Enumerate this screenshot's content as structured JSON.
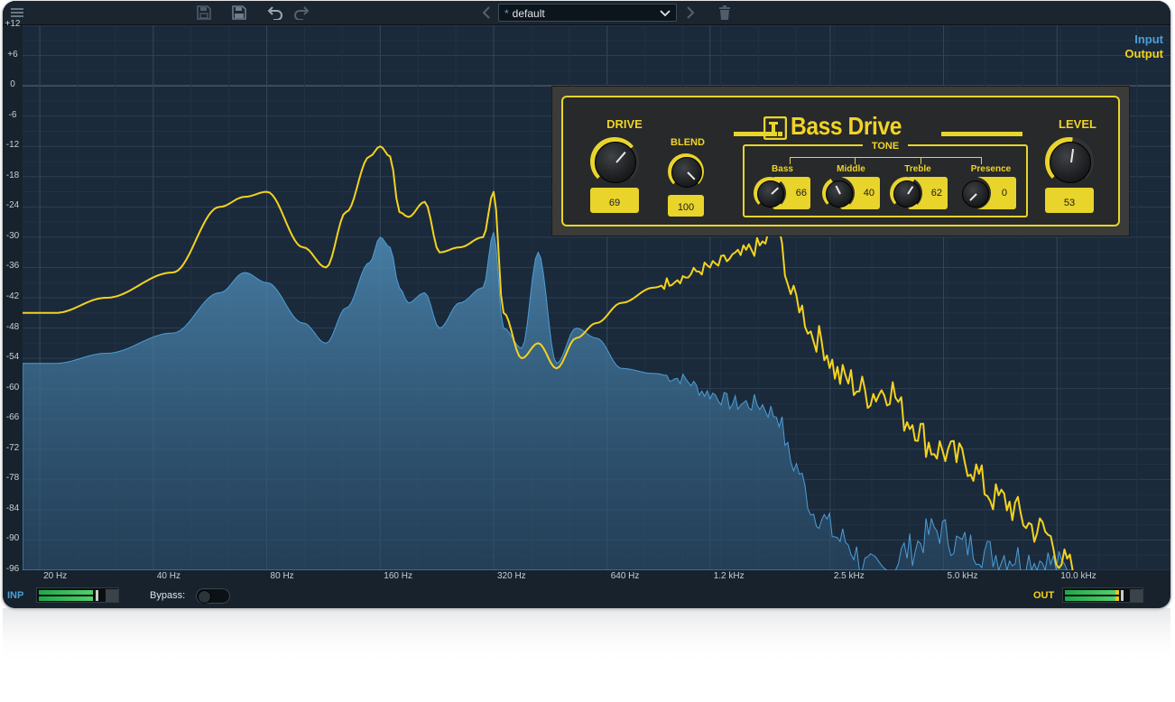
{
  "toolbar": {
    "preset": {
      "modified_marker": "*",
      "name": "default"
    }
  },
  "legend": {
    "input": "Input",
    "output": "Output"
  },
  "colors": {
    "input": "#4b9ed8",
    "output": "#f4d21f",
    "background": "#1a2a3b",
    "panel_accent": "#e9d42c"
  },
  "y_axis": {
    "labels": [
      "+12",
      "+6",
      "0",
      "-6",
      "-12",
      "-18",
      "-24",
      "-30",
      "-36",
      "-42",
      "-48",
      "-54",
      "-60",
      "-66",
      "-72",
      "-78",
      "-84",
      "-90",
      "-96"
    ]
  },
  "x_axis": {
    "labels": [
      "20 Hz",
      "40 Hz",
      "80 Hz",
      "160 Hz",
      "320 Hz",
      "640 Hz",
      "1.2 kHz",
      "2.5 kHz",
      "5.0 kHz",
      "10.0 kHz"
    ]
  },
  "plugin": {
    "title": "Bass Drive",
    "drive": {
      "label": "DRIVE",
      "value": "69"
    },
    "blend": {
      "label": "BLEND",
      "value": "100"
    },
    "level": {
      "label": "LEVEL",
      "value": "53"
    },
    "tone": {
      "label": "TONE",
      "bass": {
        "label": "Bass",
        "value": "66"
      },
      "middle": {
        "label": "Middle",
        "value": "40"
      },
      "treble": {
        "label": "Treble",
        "value": "62"
      },
      "presence": {
        "label": "Presence",
        "value": "0"
      }
    }
  },
  "footer": {
    "input_label": "INP",
    "output_label": "OUT",
    "bypass_label": "Bypass:"
  },
  "chart_data": {
    "type": "area",
    "x_scale": "log",
    "ylim": [
      -96,
      12
    ],
    "xlim_hz": [
      18,
      20000
    ],
    "series": [
      {
        "name": "Input",
        "x": [
          18,
          22,
          30,
          45,
          60,
          70,
          80,
          100,
          115,
          130,
          150,
          160,
          170,
          180,
          190,
          210,
          230,
          260,
          300,
          320,
          340,
          380,
          420,
          470,
          530,
          600,
          700,
          850,
          1000,
          1200,
          1400,
          1600,
          1800,
          2000,
          2300,
          2700,
          3200,
          3600,
          4000,
          4800,
          5600,
          7000,
          9000,
          11000
        ],
        "y": [
          -55,
          -55,
          -53,
          -49,
          -41,
          -37,
          -39,
          -47,
          -51,
          -44,
          -35,
          -30,
          -32,
          -40,
          -43,
          -41,
          -48,
          -43,
          -40,
          -29,
          -48,
          -52,
          -33,
          -55,
          -48,
          -50,
          -56,
          -57,
          -58,
          -61,
          -63,
          -63,
          -65,
          -75,
          -85,
          -90,
          -96,
          -96,
          -92,
          -88,
          -91,
          -93,
          -94,
          -96
        ]
      },
      {
        "name": "Output",
        "x": [
          18,
          22,
          30,
          45,
          60,
          70,
          80,
          100,
          115,
          130,
          150,
          160,
          170,
          180,
          190,
          210,
          230,
          260,
          300,
          320,
          340,
          380,
          420,
          470,
          530,
          600,
          700,
          850,
          1000,
          1200,
          1400,
          1600,
          1800,
          2000,
          2300,
          2700,
          3200,
          3600,
          4000,
          4800,
          5600,
          7000,
          9000,
          11000
        ],
        "y": [
          -45,
          -45,
          -42,
          -37,
          -24,
          -22,
          -21,
          -32,
          -36,
          -25,
          -14,
          -12,
          -14,
          -25,
          -26,
          -23,
          -33,
          -32,
          -30,
          -21,
          -45,
          -54,
          -51,
          -56,
          -50,
          -47,
          -43,
          -40,
          -38,
          -36,
          -34,
          -32,
          -29,
          -42,
          -50,
          -58,
          -61,
          -60,
          -66,
          -72,
          -74,
          -82,
          -88,
          -96
        ]
      }
    ]
  }
}
